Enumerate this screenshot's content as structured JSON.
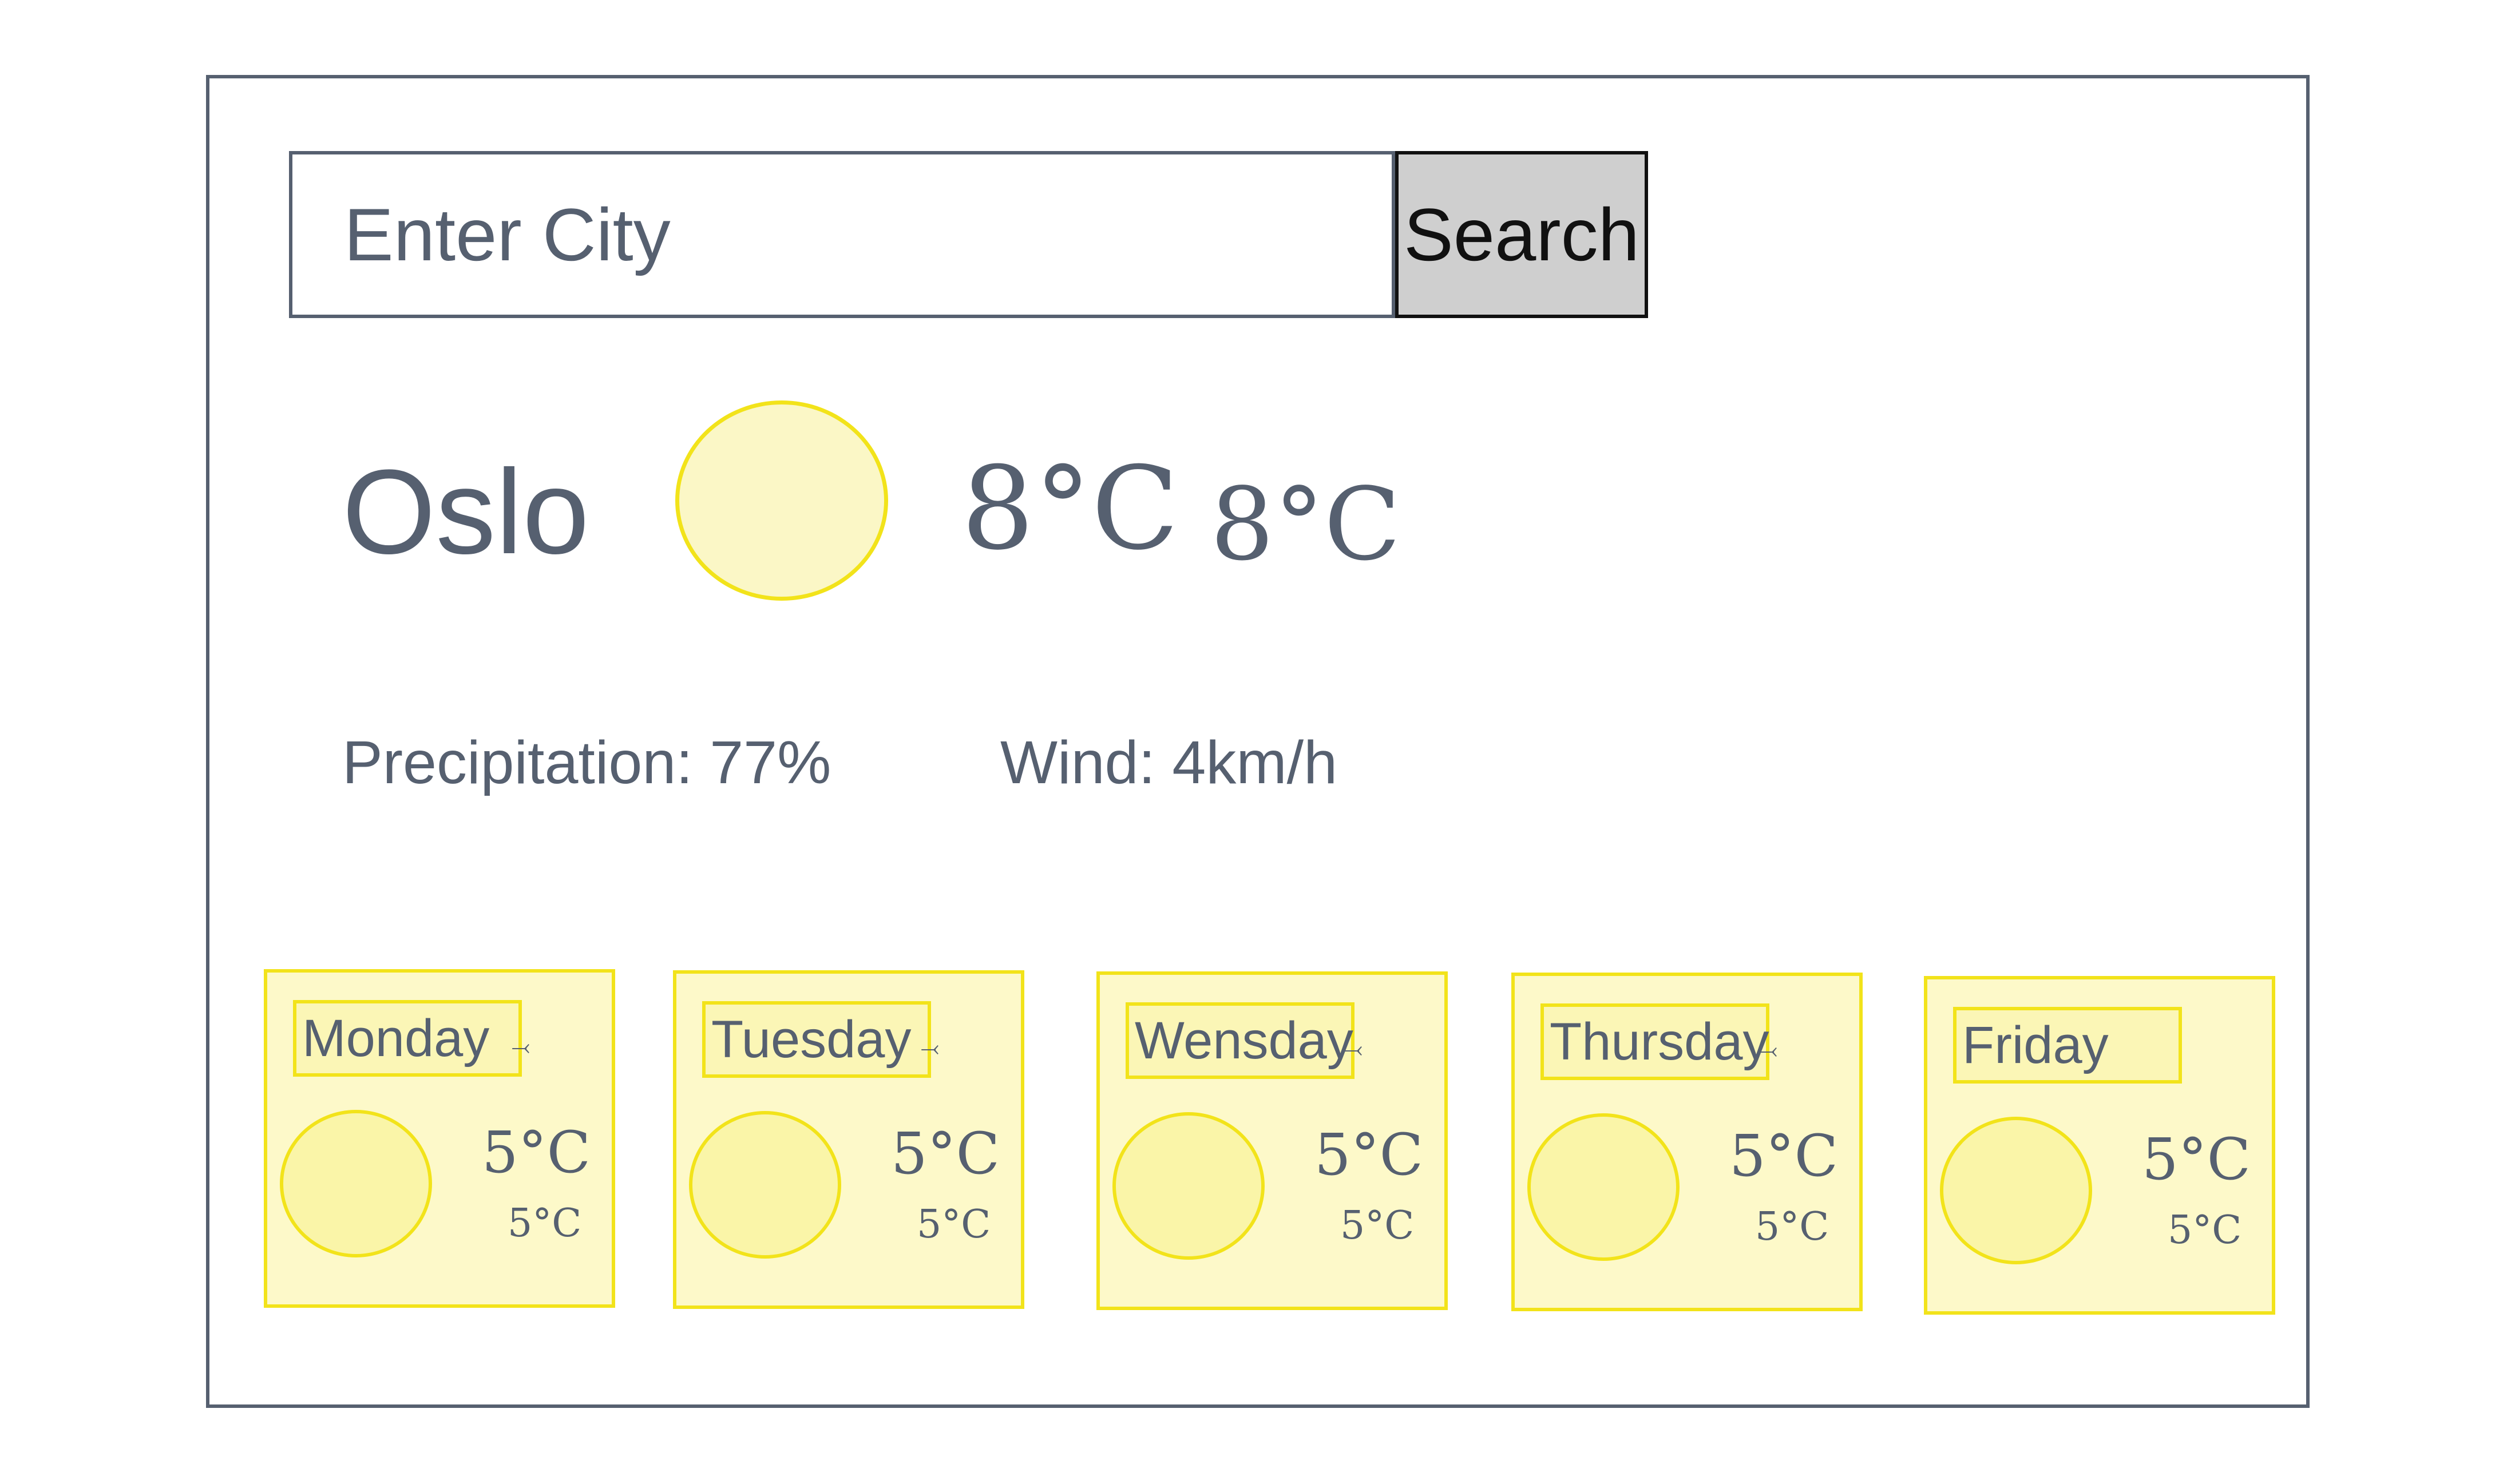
{
  "search": {
    "placeholder": "Enter City",
    "button_label": "Search"
  },
  "current": {
    "city": "Oslo",
    "icon": "sun-icon",
    "temperature": "8°C",
    "temperature_secondary": "8°C",
    "precipitation": "Precipitation: 77%",
    "wind": "Wind: 4km/h"
  },
  "forecast": [
    {
      "day": "Monday",
      "icon": "sun-icon",
      "temp_hi": "5°C",
      "temp_lo": "5°C"
    },
    {
      "day": "Tuesday",
      "icon": "sun-icon",
      "temp_hi": "5°C",
      "temp_lo": "5°C"
    },
    {
      "day": "Wensday",
      "icon": "sun-icon",
      "temp_hi": "5°C",
      "temp_lo": "5°C"
    },
    {
      "day": "Thursday",
      "icon": "sun-icon",
      "temp_hi": "5°C",
      "temp_lo": "5°C"
    },
    {
      "day": "Friday",
      "icon": "sun-icon",
      "temp_hi": "5°C",
      "temp_lo": "5°C"
    }
  ],
  "colors": {
    "text": "#566070",
    "sun_fill": "#fbf7c6",
    "sun_stroke": "#f2e31a",
    "button_bg": "#cfcfcf"
  }
}
